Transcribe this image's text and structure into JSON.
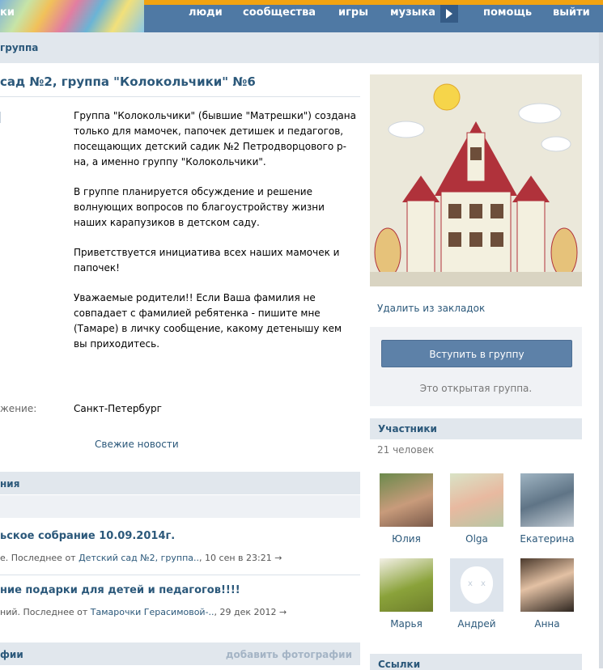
{
  "topbar": {
    "left_label": "ки",
    "nav": [
      "люди",
      "сообщества",
      "игры",
      "музыка",
      "помощь",
      "выйти"
    ],
    "colors": {
      "bar": "#4f79a4",
      "accent": "#f2a311"
    }
  },
  "breadcrumb": "группа",
  "page_title": "сад №2, группа \"Колокольчики\" №6",
  "description": [
    "Группа \"Колокольчики\" (бывшие \"Матрешки\") создана только для мамочек, папочек детишек и педагогов, посещающих детский садик №2 Петродворцового р-на, а именно группу \"Колокольчики\".",
    "В группе планируется обсуждение и решение волнующих вопросов по благоустройству жизни наших карапузиков в детском саду.",
    "Приветствуется инициатива всех наших мамочек и папочек!",
    "Уважаемые родители!! Если Ваша фамилия не совпадает с фамилией ребятенка - пишите мне (Тамаре) в личку сообщение, какому детенышу кем вы приходитесь."
  ],
  "location": {
    "label": "жение:",
    "value": "Санкт-Петербург"
  },
  "fresh_news": "Свежие новости",
  "discussions": {
    "header": "ния",
    "topics": [
      {
        "title": "ьское собрание 10.09.2014г.",
        "meta_prefix": "е. Последнее от ",
        "author": "Детский сад №2, группа..",
        "date": ", 10 сен в 23:21 →"
      },
      {
        "title": "ние подарки для детей и педагогов!!!!",
        "meta_prefix": "ний. Последнее от ",
        "author": "Тамарочки Герасимовой-..",
        "date": ", 29 дек 2012 →"
      }
    ]
  },
  "photos": {
    "header": "фии",
    "add_link": "добавить фотографии"
  },
  "sidebar": {
    "unbookmark": "Удалить из закладок",
    "join_button": "Вступить в группу",
    "open_group": "Это открытая группа.",
    "members_header": "Участники",
    "members_count": "21 человек",
    "members": [
      "Юлия",
      "Olga",
      "Екатерина",
      "Марья",
      "Андрей",
      "Анна"
    ],
    "links_header": "Ссылки"
  }
}
